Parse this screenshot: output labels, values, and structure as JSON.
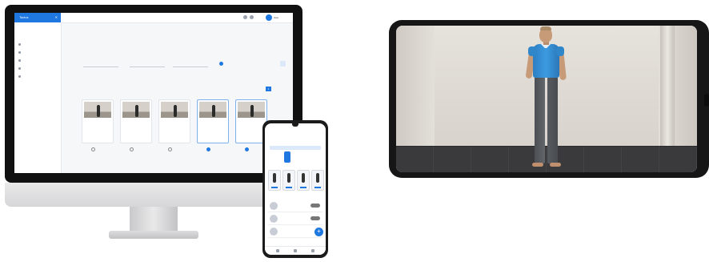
{
  "desktop_app": {
    "brand": "Tactus",
    "collapse_icon": "x-icon",
    "user_name": "User",
    "sidebar": {
      "heading": "",
      "items": [
        {
          "icon": "dashboard-icon",
          "label": ""
        },
        {
          "icon": "calendar-icon",
          "label": ""
        },
        {
          "icon": "exercise-icon",
          "label": ""
        },
        {
          "icon": "patients-icon",
          "label": ""
        },
        {
          "icon": "settings-icon",
          "label": ""
        }
      ]
    },
    "page_title": "",
    "header_links": [
      "",
      ""
    ],
    "tabs": [
      {
        "label": "",
        "active": true
      },
      {
        "label": "",
        "active": false
      },
      {
        "label": "",
        "active": false
      },
      {
        "label": "",
        "active": false
      }
    ],
    "filters": [
      "",
      "",
      ""
    ],
    "filter_toggle_label": "",
    "sort_label": "",
    "pager": {
      "prev": "",
      "current": "1",
      "next": ""
    },
    "cards": [
      {
        "name": "",
        "meta": "",
        "selected": false
      },
      {
        "name": "",
        "meta": "",
        "selected": false
      },
      {
        "name": "",
        "meta": "",
        "selected": false
      },
      {
        "name": "",
        "meta": "",
        "selected": true
      },
      {
        "name": "",
        "meta": "",
        "selected": true
      }
    ],
    "card_select_label": ""
  },
  "mobile_app": {
    "title": "",
    "date_label": "",
    "week_days": [
      "",
      "",
      "",
      "",
      "",
      "",
      ""
    ],
    "selected_day_index": 2,
    "section_label": "",
    "rows": [
      {
        "name": "",
        "status": "",
        "pill": ""
      },
      {
        "name": "",
        "status": "",
        "pill": ""
      },
      {
        "name": "",
        "status": "",
        "pill": ""
      }
    ],
    "fab_label": "+"
  },
  "avatar_view": {
    "description": "3D avatar",
    "shirt_color": "#3d9be0",
    "pants_color": "#55595e"
  },
  "colors": {
    "accent": "#1e78e0",
    "monitor_bezel": "#111111",
    "phone_body": "#161616"
  }
}
